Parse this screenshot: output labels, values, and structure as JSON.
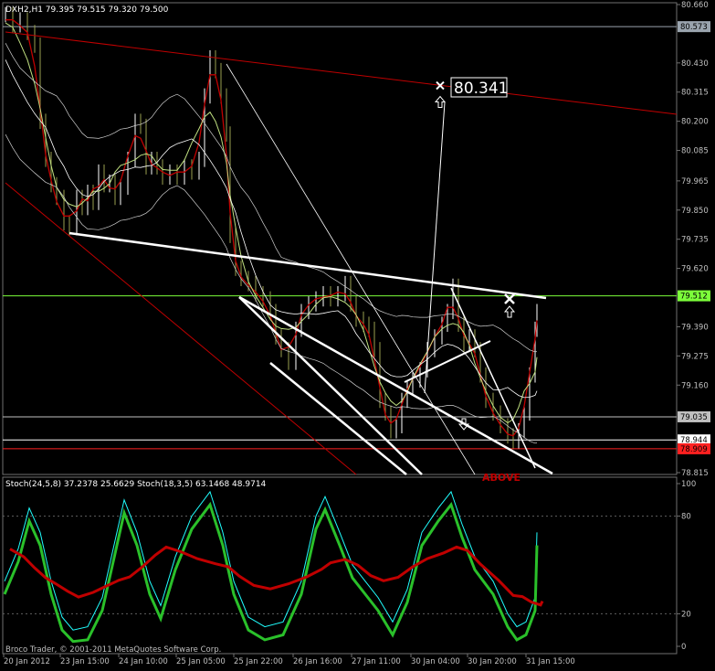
{
  "chart_data": [
    {
      "type": "candlestick",
      "title": "DXH2,H1  79.395 79.515 79.320 79.500",
      "y_axis_labels": [
        "80.660",
        "80.573",
        "80.430",
        "80.315",
        "80.200",
        "80.085",
        "79.965",
        "79.850",
        "79.735",
        "79.620",
        "79.512",
        "79.390",
        "79.275",
        "79.160",
        "79.035",
        "78.944",
        "78.909",
        "78.815"
      ],
      "ylim": [
        78.815,
        80.66
      ],
      "price_markers": [
        {
          "value": 80.573,
          "label": "80.573",
          "color": "#9aa4ae"
        },
        {
          "value": 79.512,
          "label": "79.512",
          "color": "#7cff3a"
        },
        {
          "value": 79.035,
          "label": "79.035",
          "color": "#c0c0c0"
        },
        {
          "value": 78.944,
          "label": "78.944",
          "color": "#ffffff"
        },
        {
          "value": 78.909,
          "label": "78.909",
          "color": "#ff2020"
        }
      ],
      "annotation": {
        "text": "80.341",
        "value": 80.341
      },
      "watermark_text": "ABOVE"
    },
    {
      "type": "line",
      "title": "Stoch(24,5,8) 37.2378 25.6629  Stoch(18,3,5) 63.1468 48.9714",
      "ylim": [
        0,
        100
      ],
      "y_axis_labels": [
        "100",
        "80",
        "20",
        "0"
      ],
      "levels": [
        80,
        20
      ],
      "series_colors": [
        "#20ffff",
        "#2ac02a",
        "#c00000"
      ]
    }
  ],
  "x_axis": {
    "tick_labels": [
      "20 Jan 2012",
      "23 Jan 15:00",
      "24 Jan 10:00",
      "25 Jan 05:00",
      "25 Jan 22:00",
      "26 Jan 16:00",
      "27 Jan 11:00",
      "30 Jan 04:00",
      "30 Jan 20:00",
      "31 Jan 15:00"
    ]
  },
  "copyright": "Broco Trader, © 2001-2011 MetaQuotes Software Corp."
}
